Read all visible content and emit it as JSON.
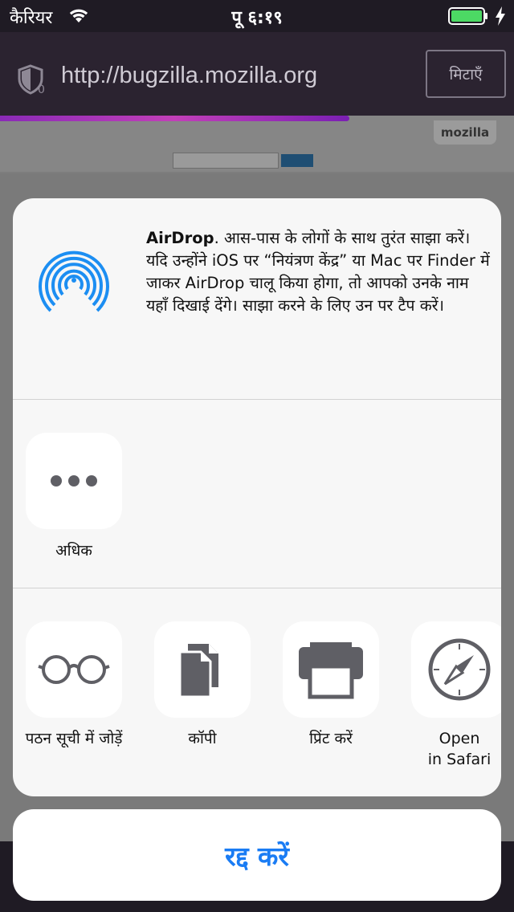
{
  "status": {
    "carrier": "कैरियर",
    "time": "पू ६:१९"
  },
  "browser": {
    "url": "http://bugzilla.mozilla.org",
    "clear_label": "मिटाएँ",
    "page_tab": "mozilla",
    "progress_fraction": 0.68
  },
  "airdrop": {
    "title": "AirDrop",
    "description": ". आस-पास के लोगों के साथ तुरंत साझा करें। यदि उन्होंने iOS पर “नियंत्रण केंद्र” या Mac पर Finder में जाकर AirDrop चालू किया होगा, तो आपको उनके नाम यहाँ दिखाई देंगे। साझा करने के लिए उन पर टैप करें।"
  },
  "share_apps": [
    {
      "label": "अधिक",
      "icon": "more-icon"
    }
  ],
  "actions": [
    {
      "label": "पठन सूची में जोड़ें",
      "icon": "glasses-icon"
    },
    {
      "label": "कॉपी",
      "icon": "copy-icon"
    },
    {
      "label": "प्रिंट करें",
      "icon": "printer-icon"
    },
    {
      "label": "Open\nin Safari",
      "icon": "compass-icon"
    }
  ],
  "cancel_label": "रद्द करें",
  "colors": {
    "accent": "#1a7cf4",
    "airdrop_blue": "#1c8ef2",
    "icon_gray": "#5f5f65",
    "battery_green": "#4cd964"
  }
}
